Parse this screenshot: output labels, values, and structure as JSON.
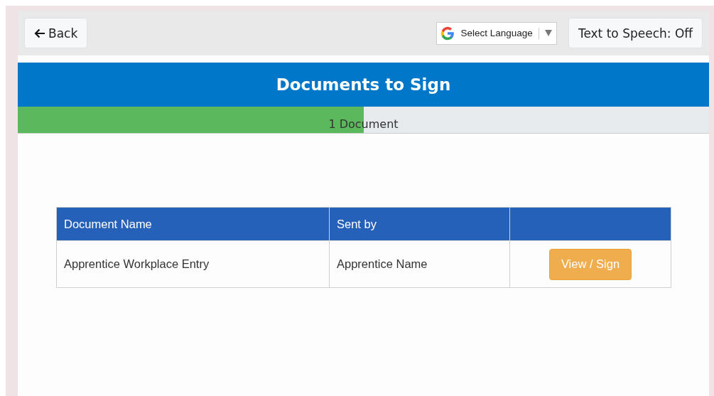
{
  "toolbar": {
    "back_button": {
      "label": "Back"
    },
    "language_select": {
      "label": "Select Language"
    },
    "speech_button": {
      "label": "Text to Speech: Off"
    }
  },
  "header": {
    "title": "Documents to Sign"
  },
  "progress": {
    "level": 0.5,
    "label": "1 Document"
  },
  "table": {
    "columns": [
      "Document Name",
      "Sent by",
      ""
    ],
    "rows": [
      {
        "document_name": "Apprentice Workplace Entry",
        "sent_by": "Apprentice Name",
        "action": "View / Sign"
      }
    ]
  }
}
